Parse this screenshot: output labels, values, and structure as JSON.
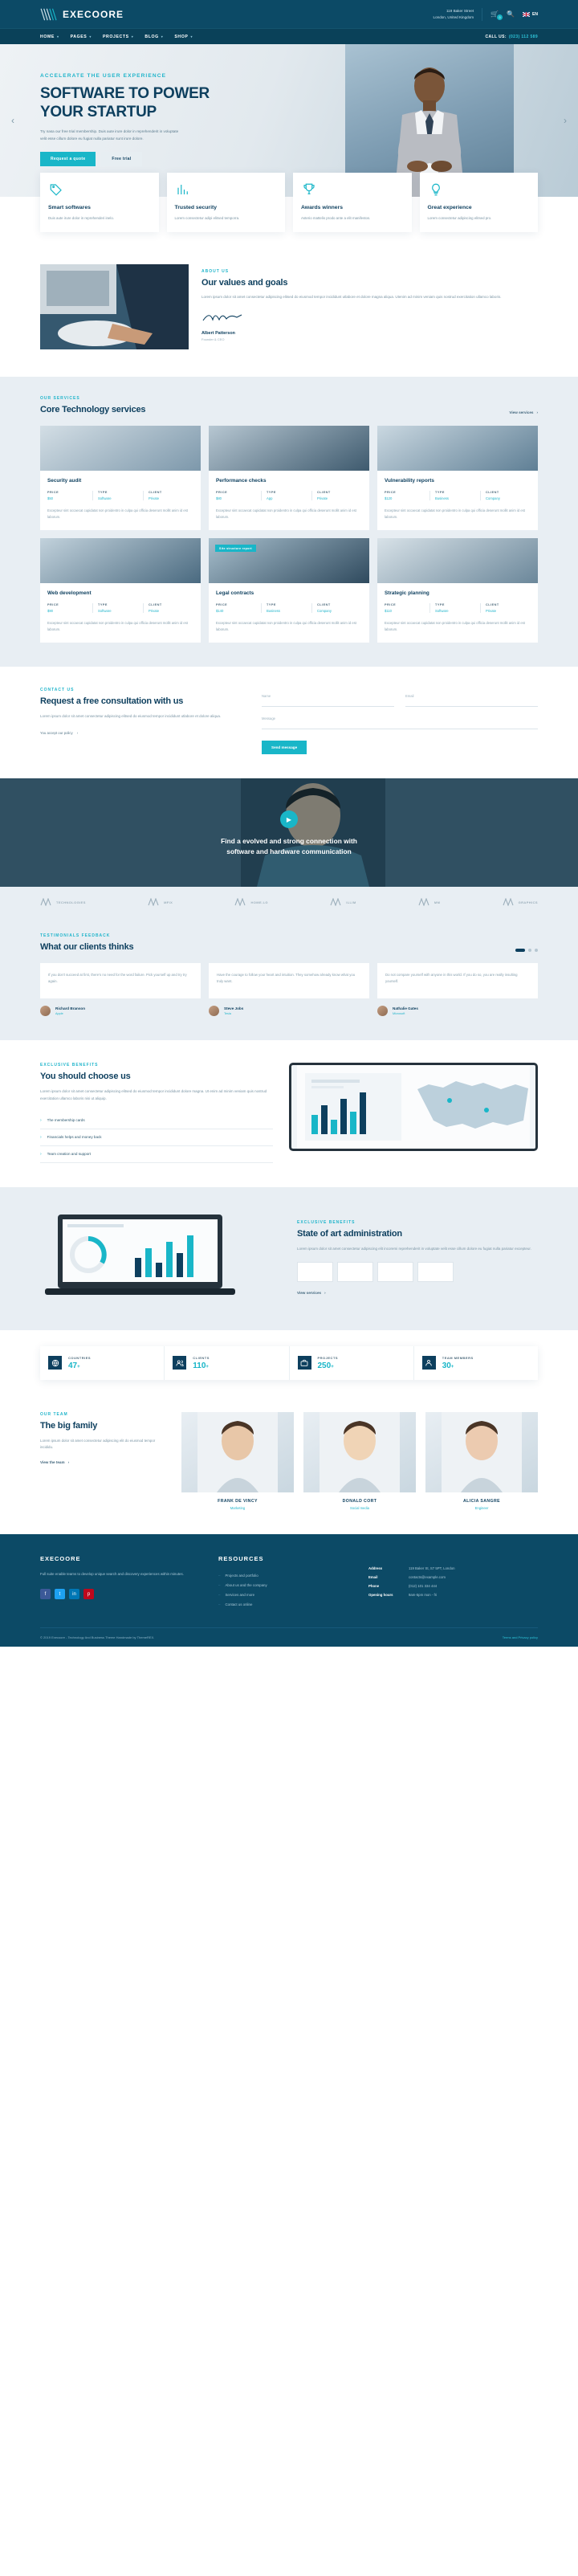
{
  "topbar": {
    "brand": "EXECOORE",
    "address_line1": "119 Baker Street",
    "address_line2": "London, United Kingdom",
    "cart_count": "0",
    "lang": "EN",
    "icons": {
      "cart": "cart-icon",
      "search": "search-icon",
      "flag": "flag-icon"
    }
  },
  "nav": {
    "items": [
      {
        "label": "HOME",
        "caret": "▾"
      },
      {
        "label": "PAGES",
        "caret": "▾"
      },
      {
        "label": "PROJECTS",
        "caret": "▾"
      },
      {
        "label": "BLOG",
        "caret": "▾"
      },
      {
        "label": "SHOP",
        "caret": "▾"
      }
    ],
    "call_label": "CALL US:",
    "call_number": "(023) 112 589"
  },
  "hero": {
    "eyebrow": "ACCELERATE THE USER EXPERIENCE",
    "title": "SOFTWARE TO POWER YOUR STARTUP",
    "paragraph": "Try nasa our free trial membership. Duis aute irure dolor in reprehenderit in voluptate velit esse cillum dolore eu fugiat nulla pariatur sunt irure dolore.",
    "btn_primary": "Request a quote",
    "btn_secondary": "Free trial",
    "arrow_left": "‹",
    "arrow_right": "›"
  },
  "features": [
    {
      "icon": "pricing-tag-icon",
      "title": "Smart softwares",
      "text": "Duis aute irure dolor in reprehenderi inelo."
    },
    {
      "icon": "bar-chart-icon",
      "title": "Trusted security",
      "text": "Lorem consectetur adipi elitsed temporra."
    },
    {
      "icon": "trophy-icon",
      "title": "Awards winners",
      "text": "Asterio mattelis prodo ante a elit manifestos."
    },
    {
      "icon": "lightbulb-icon",
      "title": "Great experience",
      "text": "Lorem consectetur adipiscing elitsed pro."
    }
  ],
  "about": {
    "label": "ABOUT US",
    "title": "Our values and goals",
    "paragraph": "Lorem ipsum dolor sit amet consectetur adipiscing elitsed do eiusmod tempor incididunt utlabore et dolore magna aliqua. Utenim ad minim veniam quis nostrud exercitation ullamco laboris.",
    "signature_name": "Albert Patterson",
    "signature_role": "Founder & CEO"
  },
  "services": {
    "label": "OUR SERVICES",
    "title": "Core Technology services",
    "view_all": "View services",
    "meta_keys": {
      "price": "PRICE",
      "type": "TYPE",
      "client": "CLIENT"
    },
    "cards": [
      {
        "title": "Security audit",
        "price": "$50",
        "type": "Software",
        "client": "Private",
        "tag": "",
        "desc": "Excepteur sint occaecat cupidatat non proidentro in culpa qui officia deserunt mollit anim id est laborum."
      },
      {
        "title": "Performance checks",
        "price": "$80",
        "type": "App",
        "client": "Private",
        "tag": "",
        "desc": "Excepteur sint occaecat cupidatat non proidentro in culpa qui officia deserunt mollit anim id est laborum."
      },
      {
        "title": "Vulnerability reports",
        "price": "$120",
        "type": "Business",
        "client": "Company",
        "tag": "",
        "desc": "Excepteur sint occaecat cupidatat non proidentro in culpa qui officia deserunt mollit anim id est laborum."
      },
      {
        "title": "Web development",
        "price": "$90",
        "type": "Software",
        "client": "Private",
        "tag": "",
        "desc": "Excepteur sint occaecat cupidatat non proidentro in culpa qui officia deserunt mollit anim id est laborum."
      },
      {
        "title": "Legal contracts",
        "price": "$140",
        "type": "Business",
        "client": "Company",
        "tag": "Site structure report",
        "desc": "Excepteur sint occaecat cupidatat non proidentro in culpa qui officia deserunt mollit anim id est laborum."
      },
      {
        "title": "Strategic planning",
        "price": "$110",
        "type": "Software",
        "client": "Private",
        "tag": "",
        "desc": "Excepteur sint occaecat cupidatat non proidentro in culpa qui officia deserunt mollit anim id est laborum."
      }
    ]
  },
  "contact": {
    "label": "CONTACT US",
    "title": "Request a free consultation with us",
    "paragraph": "Lorem ipsum dolor sit amet consectetur adipiscing elitsed do eiusmod tempor incididunt utlabore et dolore aliqua.",
    "policy": "You accept our policy",
    "fields": {
      "name": "Name",
      "email": "Email",
      "message": "Message"
    },
    "submit": "Send message"
  },
  "video": {
    "headline_line1": "Find a evolved and strong connection with",
    "headline_line2": "software and hardware communication",
    "play_icon": "play-icon",
    "brands": [
      "TECHNOLOGIES",
      "MFIX",
      "HOME.LG",
      "ILLIM",
      "MM",
      "GRAPHICS"
    ]
  },
  "testimonials": {
    "label": "TESTIMONIALS FEEDBACK",
    "title": "What our clients thinks",
    "items": [
      {
        "text": "If you don't succeed at first, there's no need for the word failure. Pick yourself up and try try again.",
        "name": "Richard Branson",
        "role": "Apple"
      },
      {
        "text": "Have the courage to follow your heart and intuition. They somehow already know what you truly want.",
        "name": "Steve Jobs",
        "role": "Tesla"
      },
      {
        "text": "Do not compare yourself with anyone in this world. If you do so, you are really insulting yourself.",
        "name": "Nathalie Gates",
        "role": "Microsoft"
      }
    ]
  },
  "benefits": {
    "label": "EXCLUSIVE BENEFITS",
    "title": "You should choose us",
    "paragraph": "Lorem ipsum dolor sit amet consectetur adipiscing elitsed do eiusmod tempor incididunt dolore magna. Ut enim ad minim veniam quis nostrud exercitation ullamco laboris nisi ut aliquip.",
    "items": [
      "The membership cards",
      "Financials helps and money back",
      "Team creation and support"
    ]
  },
  "stateart": {
    "label": "EXCLUSIVE BENEFITS",
    "title": "State of art administration",
    "paragraph": "Lorem ipsum dolor sit amet consectetur adipiscing elit incoremi reprehenderit in voluptate velit esse cillum dolore eu fugiat nulla pariatur excepteur.",
    "view_more": "View services"
  },
  "counters": [
    {
      "icon": "globe-icon",
      "label": "COUNTRIES",
      "value": "47",
      "suffix": "+"
    },
    {
      "icon": "users-icon",
      "label": "CLIENTS",
      "value": "110",
      "suffix": "+"
    },
    {
      "icon": "briefcase-icon",
      "label": "PROJECTS",
      "value": "250",
      "suffix": "+"
    },
    {
      "icon": "team-icon",
      "label": "TEAM MEMBERS",
      "value": "30",
      "suffix": "+"
    }
  ],
  "team": {
    "label": "OUR TEAM",
    "title": "The big family",
    "paragraph": "Lorem ipsum dolor sit amet consectetur adipiscing elit do eiusmod tempor incididu.",
    "view_link": "View the team",
    "members": [
      {
        "name": "FRANK DE VINCY",
        "role": "Marketing"
      },
      {
        "name": "DONALD CORT",
        "role": "Social media"
      },
      {
        "name": "ALICIA SANGRE",
        "role": "Engineer"
      }
    ]
  },
  "footer": {
    "brand": "EXECOORE",
    "brand_text": "Full suite enable teams to develop unique search and discovery experiences within minutes.",
    "resources_title": "RESOURCES",
    "resources": [
      "Projects and portfolio",
      "About us and the company",
      "Services and more",
      "Contact us online"
    ],
    "info": [
      {
        "key": "Address",
        "value": "119 Baker St, S7 5PT, London"
      },
      {
        "key": "Email",
        "value": "contacts@example.com"
      },
      {
        "key": "Phone",
        "value": "(012) 101 334 444"
      },
      {
        "key": "Opening hours",
        "value": "9am-5pm mon - fri"
      }
    ],
    "socials": [
      {
        "name": "facebook-icon",
        "glyph": "f",
        "color": "#3b5998"
      },
      {
        "name": "twitter-icon",
        "glyph": "t",
        "color": "#1da1f2"
      },
      {
        "name": "linkedin-icon",
        "glyph": "in",
        "color": "#0077b5"
      },
      {
        "name": "pinterest-icon",
        "glyph": "p",
        "color": "#bd081c"
      }
    ],
    "copyright": "© 2019 Execoore - Technology And Business Theme Handmade by ThemeREX.",
    "terms": "Terms and Privacy policy"
  },
  "colors": {
    "brand": "#0c4a66",
    "accent": "#19b6c8",
    "dark": "#0d3f5e"
  }
}
